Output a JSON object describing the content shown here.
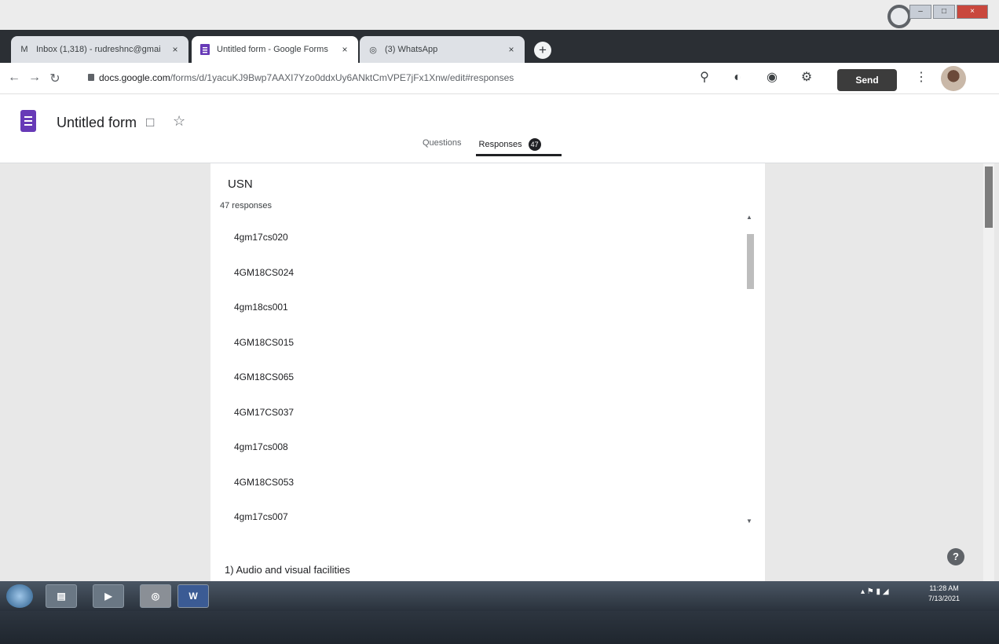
{
  "browser": {
    "tabs": [
      {
        "title": "Inbox (1,318) - rudreshnc@gmai",
        "icon": "gmail-icon",
        "active": false
      },
      {
        "title": "Untitled form - Google Forms",
        "icon": "forms-icon",
        "active": true
      },
      {
        "title": "(3) WhatsApp",
        "icon": "whatsapp-icon",
        "active": false
      }
    ],
    "new_tab_label": "+",
    "url": "docs.google.com",
    "url_path": "/forms/d/1yacuKJ9Bwp7AAXI7Yzo0ddxUy6ANktCmVPE7jFx1Xnw/edit#responses"
  },
  "forms_toolbar": {
    "send_label": "Send"
  },
  "header": {
    "form_title": "Untitled form",
    "tabs": [
      {
        "label": "Questions"
      },
      {
        "label": "Responses",
        "badge": "47"
      }
    ]
  },
  "question": {
    "title": "USN",
    "response_count": "47 responses",
    "responses": [
      "4gm17cs020",
      "4GM18CS024",
      "4gm18cs001",
      "4GM18CS015",
      "4GM18CS065",
      "4GM17CS037",
      "4gm17cs008",
      "4GM18CS053",
      "4gm17cs007"
    ]
  },
  "next_question": {
    "title": "1) Audio and visual facilities"
  },
  "taskbar": {
    "word_label": "W",
    "time": "11:28 AM",
    "date": "7/13/2021"
  },
  "colors": {
    "forms_purple": "#673ab7",
    "send_button": "#3c3c3c",
    "tab_strip": "#2b2f34"
  }
}
